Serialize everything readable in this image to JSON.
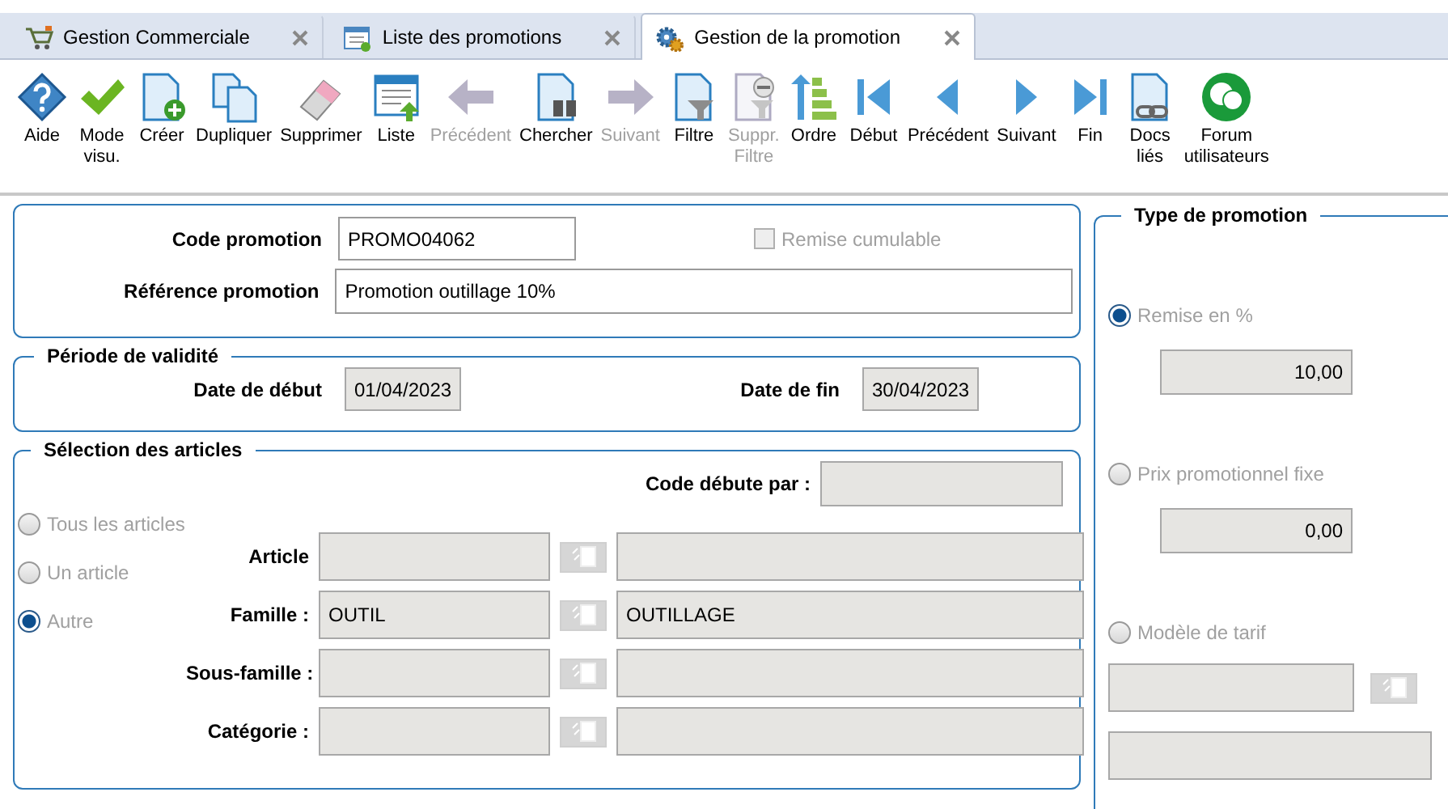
{
  "tabs": [
    {
      "label": "Gestion Commerciale",
      "selected": false
    },
    {
      "label": "Liste des promotions",
      "selected": false
    },
    {
      "label": "Gestion de la promotion",
      "selected": true
    }
  ],
  "toolbar": [
    {
      "label": "Aide",
      "disabled": false
    },
    {
      "label": "Mode\nvisu.",
      "disabled": false
    },
    {
      "label": "Créer",
      "disabled": false
    },
    {
      "label": "Dupliquer",
      "disabled": false
    },
    {
      "label": "Supprimer",
      "disabled": false
    },
    {
      "label": "Liste",
      "disabled": false
    },
    {
      "label": "Précédent",
      "disabled": true
    },
    {
      "label": "Chercher",
      "disabled": false
    },
    {
      "label": "Suivant",
      "disabled": true
    },
    {
      "label": "Filtre",
      "disabled": false
    },
    {
      "label": "Suppr.\nFiltre",
      "disabled": true
    },
    {
      "label": "Ordre",
      "disabled": false
    },
    {
      "label": "Début",
      "disabled": false
    },
    {
      "label": "Précédent",
      "disabled": false
    },
    {
      "label": "Suivant",
      "disabled": false
    },
    {
      "label": "Fin",
      "disabled": false
    },
    {
      "label": "Docs\nliés",
      "disabled": false
    },
    {
      "label": "Forum\nutilisateurs",
      "disabled": false
    }
  ],
  "header": {
    "code_label": "Code promotion",
    "code_value": "PROMO04062",
    "reference_label": "Référence promotion",
    "reference_value": "Promotion outillage 10%",
    "cumulative": {
      "label": "Remise cumulable",
      "checked": false,
      "disabled": true
    }
  },
  "validity": {
    "title": "Période de validité",
    "start_label": "Date de début",
    "start_value": "01/04/2023",
    "end_label": "Date de fin",
    "end_value": "30/04/2023"
  },
  "selection": {
    "title": "Sélection des articles",
    "code_prefix_label": "Code débute par :",
    "radios": [
      {
        "label": "Tous les articles",
        "selected": false
      },
      {
        "label": "Un article",
        "selected": false
      },
      {
        "label": "Autre",
        "selected": true
      }
    ],
    "rows": [
      {
        "label": "Article",
        "code": "",
        "name": ""
      },
      {
        "label": "Famille :",
        "code": "OUTIL",
        "name": "OUTILLAGE"
      },
      {
        "label": "Sous-famille :",
        "code": "",
        "name": ""
      },
      {
        "label": "Catégorie :",
        "code": "",
        "name": ""
      }
    ]
  },
  "promotion_type": {
    "title": "Type de promotion",
    "options": [
      {
        "kind": "amount",
        "label": "Remise en %",
        "selected": true,
        "value": "10,00"
      },
      {
        "kind": "amount",
        "label": "Prix promotionnel fixe",
        "selected": false,
        "value": "0,00"
      },
      {
        "kind": "model",
        "label": "Modèle de tarif",
        "selected": false
      }
    ]
  }
}
